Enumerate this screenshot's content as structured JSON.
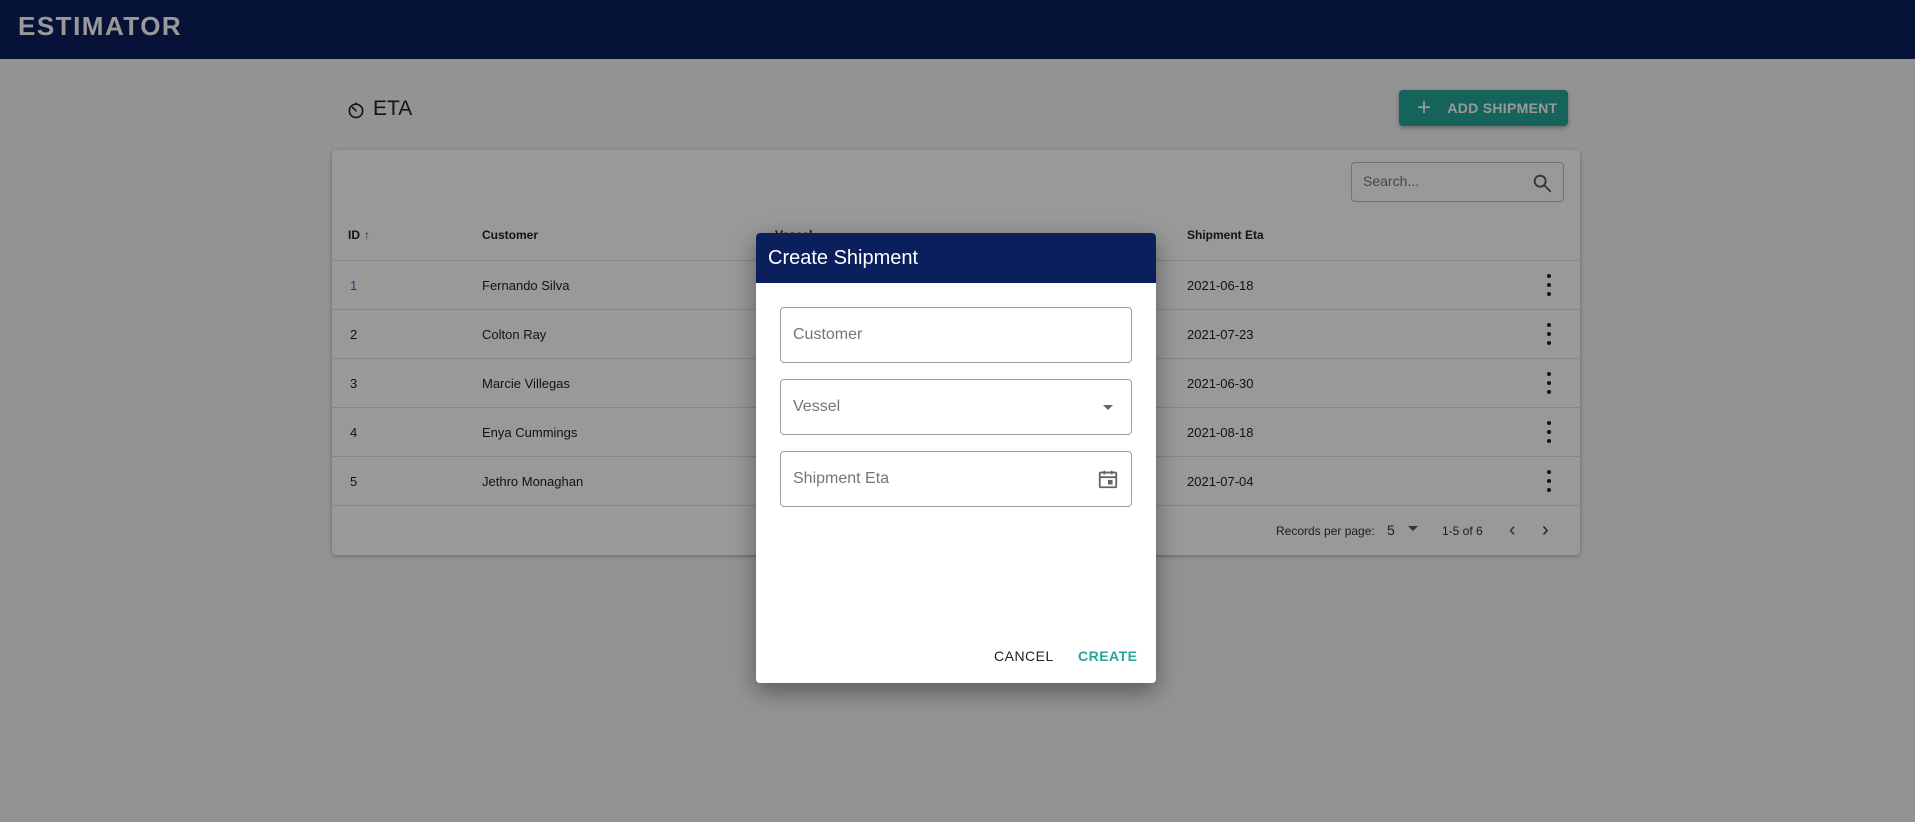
{
  "app": {
    "title": "ESTIMATOR"
  },
  "page": {
    "title": "ETA",
    "icon": "timer-icon"
  },
  "toolbar": {
    "add_label": "ADD SHIPMENT"
  },
  "search": {
    "placeholder": "Search..."
  },
  "table": {
    "columns": {
      "id": "ID",
      "customer": "Customer",
      "vessel": "Vessel",
      "eta": "Shipment Eta"
    },
    "rows": [
      {
        "id": "1",
        "customer": "Fernando Silva",
        "eta": "2021-06-18"
      },
      {
        "id": "2",
        "customer": "Colton Ray",
        "eta": "2021-07-23"
      },
      {
        "id": "3",
        "customer": "Marcie Villegas",
        "eta": "2021-06-30"
      },
      {
        "id": "4",
        "customer": "Enya Cummings",
        "eta": "2021-08-18"
      },
      {
        "id": "5",
        "customer": "Jethro Monaghan",
        "eta": "2021-07-04"
      }
    ]
  },
  "pagination": {
    "rows_per_page_label": "Records per page:",
    "rows_per_page": "5",
    "range": "1-5 of 6"
  },
  "dialog": {
    "title": "Create Shipment",
    "customer_placeholder": "Customer",
    "vessel_placeholder": "Vessel",
    "eta_placeholder": "Shipment Eta",
    "cancel_label": "CANCEL",
    "create_label": "CREATE"
  },
  "colors": {
    "appbar": "#0a1f5c",
    "accent": "#26a69a",
    "link": "#1976d2"
  }
}
